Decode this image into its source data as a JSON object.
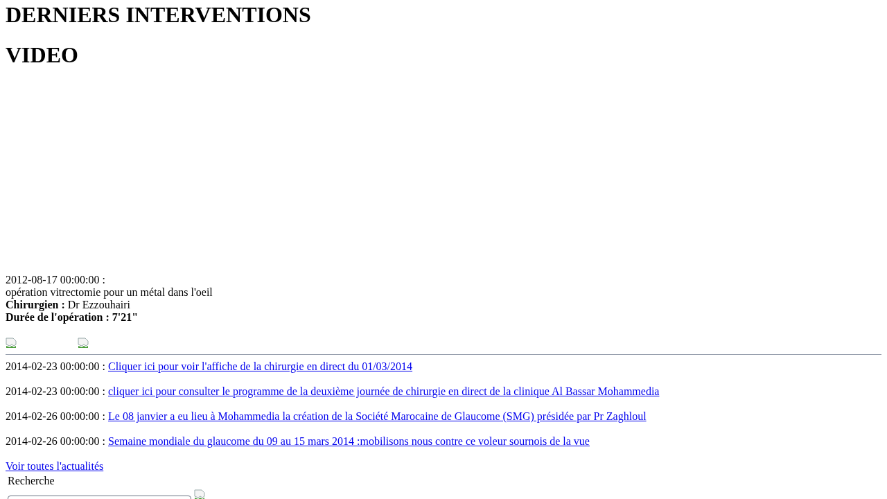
{
  "headings": [
    "DERNIERS INTERVENTIONS",
    "VIDEO"
  ],
  "video": {
    "date": "2012-08-17 00:00:00 :",
    "title": "opération vitrectomie pour un métal dans l'oeil",
    "surgeon_label": "Chirurgien :",
    "surgeon": "Dr Ezzouhairi",
    "duration_label": "Durée de l'opération : 7'21\""
  },
  "news": [
    {
      "date": "2014-02-23 00:00:00 :",
      "link": "Cliquer ici pour voir l'affiche de la chirurgie en direct du 01/03/2014"
    },
    {
      "date": "2014-02-23 00:00:00 :",
      "link": "cliquer ici pour consulter le programme de la deuxième journée de chirurgie en direct de la clinique Al Bassar Mohammedia"
    },
    {
      "date": "2014-02-26 00:00:00 :",
      "link": "Le 08 janvier a eu lieu à Mohammedia la création de la Société Marocaine de Glaucome (SMG) présidée par Pr Zaghloul"
    },
    {
      "date": "2014-02-26 00:00:00 :",
      "link": "Semaine mondiale du glaucome du 09 au 15 mars 2014 :mobilisons nous contre ce voleur sournois de la vue"
    }
  ],
  "all_news_link": "Voir toutes l'actualités",
  "search": {
    "label": "Recherche"
  }
}
